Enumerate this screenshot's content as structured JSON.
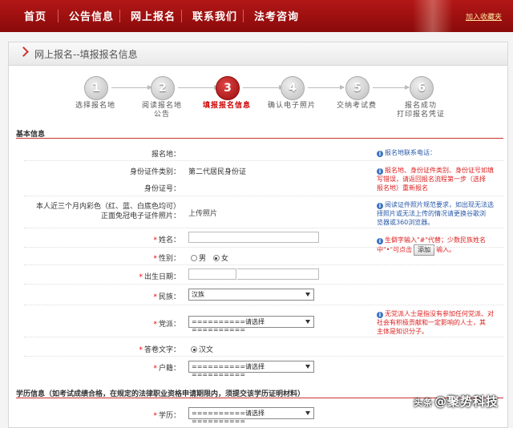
{
  "nav": {
    "items": [
      "首页",
      "公告信息",
      "网上报名",
      "联系我们",
      "法考咨询"
    ],
    "favorite": "加入收藏夹"
  },
  "panel": {
    "title": "网上报名--填报报名信息"
  },
  "steps": [
    {
      "num": "1",
      "label": "选择报名地",
      "label2": ""
    },
    {
      "num": "2",
      "label": "阅读报名地",
      "label2": "公告"
    },
    {
      "num": "3",
      "label": "填报报名信息",
      "label2": ""
    },
    {
      "num": "4",
      "label": "确认电子照片",
      "label2": ""
    },
    {
      "num": "5",
      "label": "交纳考试费",
      "label2": ""
    },
    {
      "num": "6",
      "label": "报名成功",
      "label2": "打印报名凭证"
    }
  ],
  "active_step": 3,
  "sections": {
    "basic": "基本信息",
    "education": "学历信息（如考试成绩合格，在规定的法律职业资格申请期限内，须提交该学历证明材料）"
  },
  "form": {
    "signup_place": "报名地：",
    "id_type_label": "身份证件类别：",
    "id_type_value": "第二代居民身份证",
    "id_number_label": "身份证号：",
    "photo_label_1": "本人近三个月内彩色（红、蓝、白底色均可）",
    "photo_label_2": "正面免冠电子证件照片：",
    "photo_upload": "上传照片",
    "name_label": "姓名：",
    "gender_label": "性别：",
    "gender_male": "男",
    "gender_female": "女",
    "birth_label": "出生日期：",
    "ethnic_label": "民族：",
    "ethnic_value": "汉族",
    "party_label": "党派：",
    "party_value": "==========请选择==========",
    "answer_lang_label": "答卷文字：",
    "answer_lang_value": "汉文",
    "household_label": "户籍：",
    "household_value": "==========请选择==========",
    "degree_label": "学历：",
    "degree_value": "==========请选择=========="
  },
  "tips": {
    "phone": "报名地联系电话：",
    "idtype_1": "报名地、身份证件类别、身份证号如填",
    "idtype_2": "写错误，请返回报名流程第一步（选择",
    "idtype_3": "报名地）重新报名",
    "photo_1": "阅读证件照片规范要求，如出现无法选",
    "photo_2": "择照片或无法上传的情况请更换谷歌浏",
    "photo_3": "览器或360浏览器。",
    "name_1": "生僻字输入\"#\"代替；少数民族姓名",
    "name_2a": "中\"•\"可点击",
    "add_button": "添加",
    "name_2b": "输入。",
    "party_1": "无党派人士是指没有参加任何党派、对",
    "party_2": "社会有积极贡献和一定影响的人士，其",
    "party_3": "主体是知识分子。"
  },
  "watermark": {
    "badge": "头条",
    "text": "@聚势科技"
  }
}
